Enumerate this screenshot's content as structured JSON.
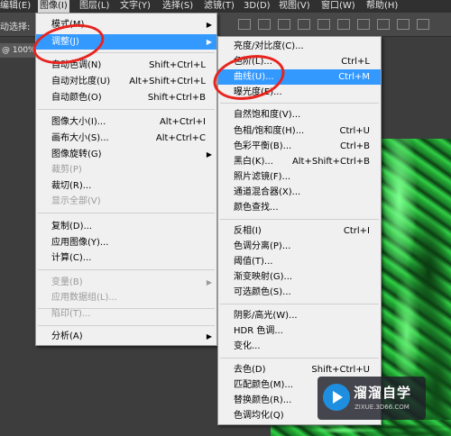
{
  "menubar": {
    "items": [
      {
        "label": "编辑(E)",
        "active": false
      },
      {
        "label": "图像(I)",
        "active": true
      },
      {
        "label": "图层(L)",
        "active": false
      },
      {
        "label": "文字(Y)",
        "active": false
      },
      {
        "label": "选择(S)",
        "active": false
      },
      {
        "label": "滤镜(T)",
        "active": false
      },
      {
        "label": "3D(D)",
        "active": false
      },
      {
        "label": "视图(V)",
        "active": false
      },
      {
        "label": "窗口(W)",
        "active": false
      },
      {
        "label": "帮助(H)",
        "active": false
      }
    ]
  },
  "options_bar": {
    "label": "动选择:"
  },
  "document_tab": {
    "label": "@ 100%"
  },
  "image_menu": {
    "items": [
      {
        "label": "模式(M)",
        "shortcut": "",
        "submenu": true,
        "disabled": false,
        "highlighted": false
      },
      {
        "label": "调整(J)",
        "shortcut": "",
        "submenu": true,
        "disabled": false,
        "highlighted": true
      },
      {
        "label": "自动色调(N)",
        "shortcut": "Shift+Ctrl+L",
        "submenu": false,
        "disabled": false,
        "highlighted": false
      },
      {
        "label": "自动对比度(U)",
        "shortcut": "Alt+Shift+Ctrl+L",
        "submenu": false,
        "disabled": false,
        "highlighted": false
      },
      {
        "label": "自动颜色(O)",
        "shortcut": "Shift+Ctrl+B",
        "submenu": false,
        "disabled": false,
        "highlighted": false
      },
      {
        "label": "图像大小(I)...",
        "shortcut": "Alt+Ctrl+I",
        "submenu": false,
        "disabled": false,
        "highlighted": false
      },
      {
        "label": "画布大小(S)...",
        "shortcut": "Alt+Ctrl+C",
        "submenu": false,
        "disabled": false,
        "highlighted": false
      },
      {
        "label": "图像旋转(G)",
        "shortcut": "",
        "submenu": true,
        "disabled": false,
        "highlighted": false
      },
      {
        "label": "裁剪(P)",
        "shortcut": "",
        "submenu": false,
        "disabled": true,
        "highlighted": false
      },
      {
        "label": "裁切(R)...",
        "shortcut": "",
        "submenu": false,
        "disabled": false,
        "highlighted": false
      },
      {
        "label": "显示全部(V)",
        "shortcut": "",
        "submenu": false,
        "disabled": true,
        "highlighted": false
      },
      {
        "label": "复制(D)...",
        "shortcut": "",
        "submenu": false,
        "disabled": false,
        "highlighted": false
      },
      {
        "label": "应用图像(Y)...",
        "shortcut": "",
        "submenu": false,
        "disabled": false,
        "highlighted": false
      },
      {
        "label": "计算(C)...",
        "shortcut": "",
        "submenu": false,
        "disabled": false,
        "highlighted": false
      },
      {
        "label": "变量(B)",
        "shortcut": "",
        "submenu": true,
        "disabled": true,
        "highlighted": false
      },
      {
        "label": "应用数据组(L)...",
        "shortcut": "",
        "submenu": false,
        "disabled": true,
        "highlighted": false
      },
      {
        "label": "陷印(T)...",
        "shortcut": "",
        "submenu": false,
        "disabled": true,
        "highlighted": false
      },
      {
        "label": "分析(A)",
        "shortcut": "",
        "submenu": true,
        "disabled": false,
        "highlighted": false
      }
    ]
  },
  "adjust_menu": {
    "items": [
      {
        "label": "亮度/对比度(C)...",
        "shortcut": "",
        "highlighted": false
      },
      {
        "label": "色阶(L)...",
        "shortcut": "Ctrl+L",
        "highlighted": false
      },
      {
        "label": "曲线(U)...",
        "shortcut": "Ctrl+M",
        "highlighted": true
      },
      {
        "label": "曝光度(E)...",
        "shortcut": "",
        "highlighted": false
      },
      {
        "label": "自然饱和度(V)...",
        "shortcut": "",
        "highlighted": false
      },
      {
        "label": "色相/饱和度(H)...",
        "shortcut": "Ctrl+U",
        "highlighted": false
      },
      {
        "label": "色彩平衡(B)...",
        "shortcut": "Ctrl+B",
        "highlighted": false
      },
      {
        "label": "黑白(K)...",
        "shortcut": "Alt+Shift+Ctrl+B",
        "highlighted": false
      },
      {
        "label": "照片滤镜(F)...",
        "shortcut": "",
        "highlighted": false
      },
      {
        "label": "通道混合器(X)...",
        "shortcut": "",
        "highlighted": false
      },
      {
        "label": "颜色查找...",
        "shortcut": "",
        "highlighted": false
      },
      {
        "label": "反相(I)",
        "shortcut": "Ctrl+I",
        "highlighted": false
      },
      {
        "label": "色调分离(P)...",
        "shortcut": "",
        "highlighted": false
      },
      {
        "label": "阈值(T)...",
        "shortcut": "",
        "highlighted": false
      },
      {
        "label": "渐变映射(G)...",
        "shortcut": "",
        "highlighted": false
      },
      {
        "label": "可选颜色(S)...",
        "shortcut": "",
        "highlighted": false
      },
      {
        "label": "阴影/高光(W)...",
        "shortcut": "",
        "highlighted": false
      },
      {
        "label": "HDR 色调...",
        "shortcut": "",
        "highlighted": false
      },
      {
        "label": "变化...",
        "shortcut": "",
        "highlighted": false
      },
      {
        "label": "去色(D)",
        "shortcut": "Shift+Ctrl+U",
        "highlighted": false
      },
      {
        "label": "匹配颜色(M)...",
        "shortcut": "",
        "highlighted": false
      },
      {
        "label": "替换颜色(R)...",
        "shortcut": "",
        "highlighted": false
      },
      {
        "label": "色调均化(Q)",
        "shortcut": "",
        "highlighted": false
      }
    ]
  },
  "watermark": {
    "brand": "溜溜自学",
    "site": "ZIXUE.3D66.COM"
  },
  "colors": {
    "highlight": "#3399ff",
    "annotation": "#e8231d",
    "menu_bg": "#f0f0f0"
  }
}
